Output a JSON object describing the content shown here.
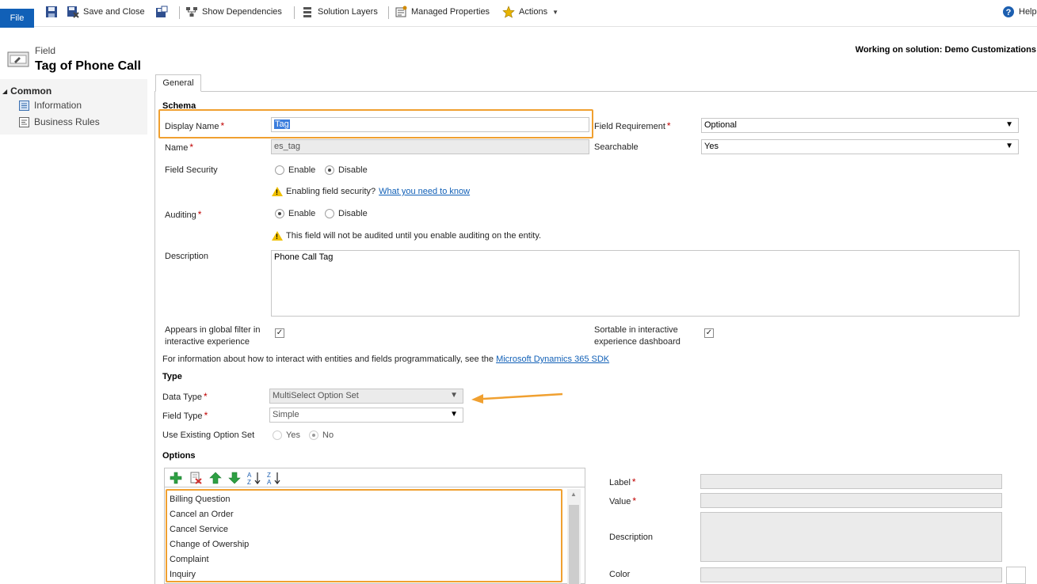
{
  "toolbar": {
    "file_label": "File",
    "save_close_label": "Save and Close",
    "show_dependencies_label": "Show Dependencies",
    "solution_layers_label": "Solution Layers",
    "managed_properties_label": "Managed Properties",
    "actions_label": "Actions",
    "help_label": "Help"
  },
  "header": {
    "kind": "Field",
    "title": "Tag of Phone Call",
    "solution": "Working on solution: Demo Customizations"
  },
  "nav": {
    "section": "Common",
    "items": [
      {
        "label": "Information"
      },
      {
        "label": "Business Rules"
      }
    ]
  },
  "tabs": [
    {
      "label": "General"
    }
  ],
  "schema": {
    "title": "Schema",
    "display_name_label": "Display Name",
    "display_name_value": "Tag",
    "name_label": "Name",
    "name_value": "es_tag",
    "field_requirement_label": "Field Requirement",
    "field_requirement_value": "Optional",
    "searchable_label": "Searchable",
    "searchable_value": "Yes",
    "field_security_label": "Field Security",
    "enable_label": "Enable",
    "disable_label": "Disable",
    "security_warn_text": "Enabling field security?",
    "security_warn_link": "What you need to know",
    "auditing_label": "Auditing",
    "audit_warn_text": "This field will not be audited until you enable auditing on the entity.",
    "description_label": "Description",
    "description_value": "Phone Call Tag",
    "global_filter_label_1": "Appears in global filter in",
    "global_filter_label_2": "interactive experience",
    "sortable_label_1": "Sortable in interactive",
    "sortable_label_2": "experience dashboard",
    "sdk_text": "For information about how to interact with entities and fields programmatically, see the",
    "sdk_link": "Microsoft Dynamics 365 SDK"
  },
  "type": {
    "title": "Type",
    "data_type_label": "Data Type",
    "data_type_value": "MultiSelect Option Set",
    "field_type_label": "Field Type",
    "field_type_value": "Simple",
    "use_existing_label": "Use Existing Option Set",
    "yes_label": "Yes",
    "no_label": "No"
  },
  "options": {
    "title": "Options",
    "items": [
      {
        "label": "Billing Question"
      },
      {
        "label": "Cancel an Order"
      },
      {
        "label": "Cancel Service"
      },
      {
        "label": "Change of Owership"
      },
      {
        "label": "Complaint"
      },
      {
        "label": "Inquiry"
      }
    ],
    "detail": {
      "label_label": "Label",
      "value_label": "Value",
      "description_label": "Description",
      "color_label": "Color"
    }
  },
  "colors": {
    "accent": "#1160b7",
    "highlight": "#f0a030",
    "required": "#c00000"
  }
}
